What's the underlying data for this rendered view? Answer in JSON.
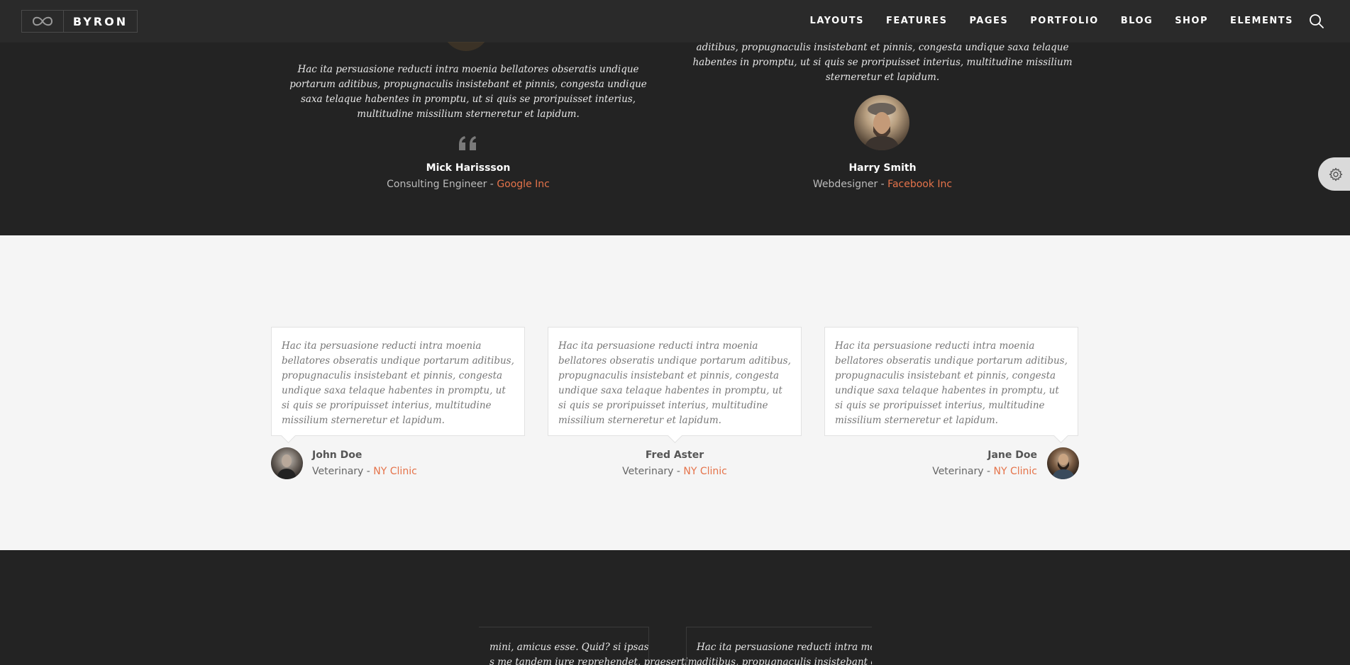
{
  "header": {
    "logo_text": "BYRON",
    "nav": [
      "LAYOUTS",
      "FEATURES",
      "PAGES",
      "PORTFOLIO",
      "BLOG",
      "SHOP",
      "ELEMENTS"
    ]
  },
  "dark_testimonials": [
    {
      "quote": "Hac ita persuasione reducti intra moenia bellatores obseratis undique portarum aditibus, propugnaculis insistebant et pinnis, congesta undique saxa telaque habentes in promptu, ut si quis se proripuisset interius, multitudine missilium sterneretur et lapidum.",
      "name": "Mick Harissson",
      "role": "Consulting Engineer - ",
      "company": "Google Inc"
    },
    {
      "quote": "aditibus, propugnaculis insistebant et pinnis, congesta undique saxa telaque habentes in promptu, ut si quis se proripuisset interius, multitudine missilium sterneretur et lapidum.",
      "name": "Harry Smith",
      "role": "Webdesigner - ",
      "company": "Facebook Inc"
    }
  ],
  "light_testimonials": [
    {
      "quote": "Hac ita persuasione reducti intra moenia bellatores obseratis undique portarum aditibus, propugnaculis insistebant et pinnis, congesta undique saxa telaque habentes in promptu, ut si quis se proripuisset interius, multitudine missilium sterneretur et lapidum.",
      "name": "John Doe",
      "role": "Veterinary - ",
      "company": "NY Clinic"
    },
    {
      "quote": "Hac ita persuasione reducti intra moenia bellatores obseratis undique portarum aditibus, propugnaculis insistebant et pinnis, congesta undique saxa telaque habentes in promptu, ut si quis se proripuisset interius, multitudine missilium sterneretur et lapidum.",
      "name": "Fred Aster",
      "role": "Veterinary - ",
      "company": "NY Clinic"
    },
    {
      "quote": "Hac ita persuasione reducti intra moenia bellatores obseratis undique portarum aditibus, propugnaculis insistebant et pinnis, congesta undique saxa telaque habentes in promptu, ut si quis se proripuisset interius, multitudine missilium sterneretur et lapidum.",
      "name": "Jane Doe",
      "role": "Veterinary - ",
      "company": "NY Clinic"
    }
  ],
  "bottom_slider": {
    "card1_line1": "mini, amicus esse. Quid? si ipsas",
    "card1_line2": "s me tandem iure reprehendet, praesertim",
    "card2_line1": "Hac ita persuasione reducti intra moeni",
    "card2_line2": "aditibus, propugnaculis insistebant et pi"
  },
  "colors": {
    "accent": "#e5734a",
    "dark_bg": "#232323",
    "header_bg": "#2a2a2a",
    "light_bg": "#f5f5f5"
  },
  "icons": [
    "infinity-logo-icon",
    "search-icon",
    "quote-icon",
    "gear-icon"
  ]
}
